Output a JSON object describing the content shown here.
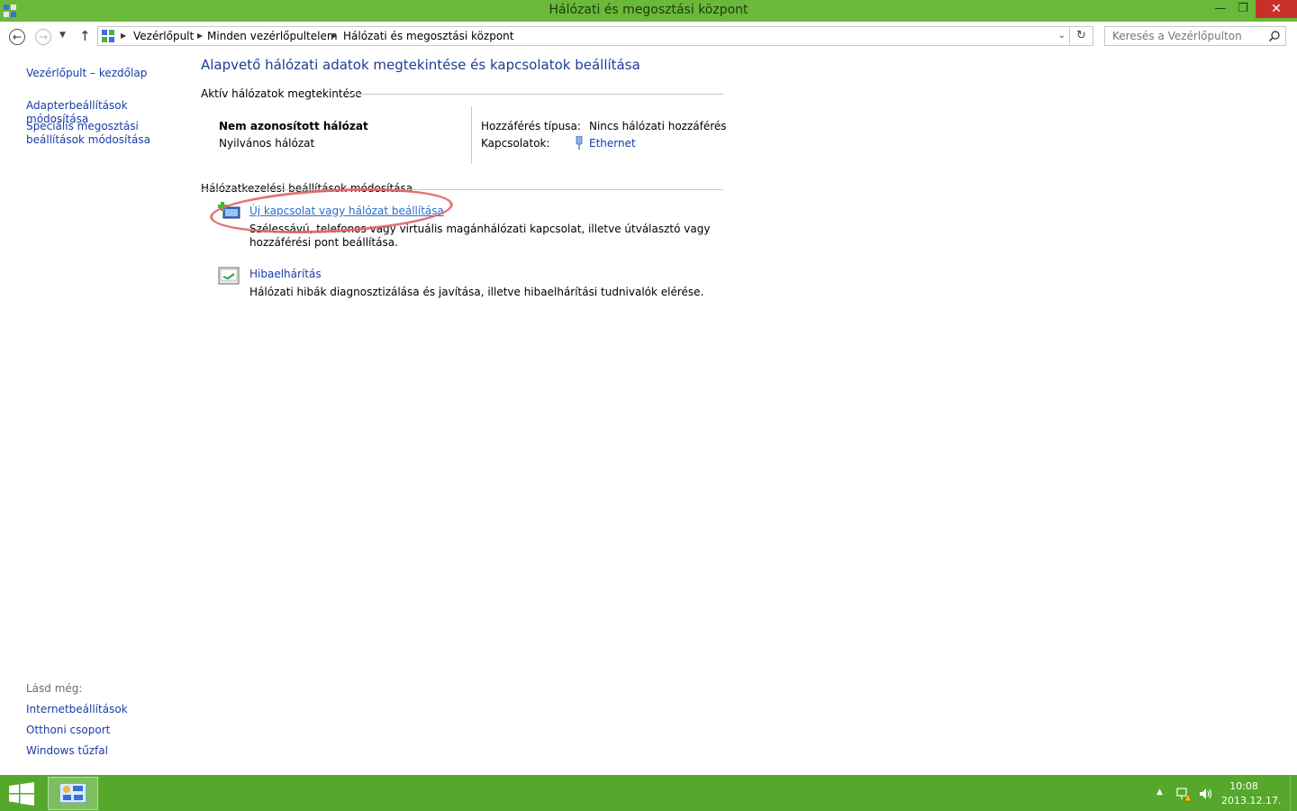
{
  "window": {
    "title": "Hálózati és megosztási központ",
    "min_label": "—",
    "max_label": "❐",
    "close_label": "✕"
  },
  "navigation": {
    "back": "←",
    "forward": "→",
    "dropdown": "▼",
    "up": "↑",
    "breadcrumbs": [
      "Vezérlőpult",
      "Minden vezérlőpultelem",
      "Hálózati és megosztási központ"
    ],
    "breadcrumb_sep": "▶",
    "address_dropdown": "⌄",
    "refresh": "↻",
    "search_placeholder": "Keresés a Vezérlőpulton"
  },
  "sidebar": {
    "home": "Vezérlőpult – kezdőlap",
    "items": [
      "Adapterbeállítások módosítása",
      "Speciális megosztási beállítások módosítása"
    ],
    "see_also_label": "Lásd még:",
    "see_also": [
      "Internetbeállítások",
      "Otthoni csoport",
      "Windows tűzfal"
    ]
  },
  "main": {
    "title": "Alapvető hálózati adatok megtekintése és kapcsolatok beállítása",
    "active_section": "Aktív hálózatok megtekintése",
    "network": {
      "name": "Nem azonosított hálózat",
      "type": "Nyilvános hálózat",
      "access_label": "Hozzáférés típusa:",
      "access_value": "Nincs hálózati hozzáférés",
      "connections_label": "Kapcsolatok:",
      "connections_value": "Ethernet"
    },
    "settings_section": "Hálózatkezelési beállítások módosítása",
    "tasks": [
      {
        "title": "Új kapcsolat vagy hálózat beállítása",
        "desc": "Szélessávú, telefonos vagy virtuális magánhálózati kapcsolat, illetve útválasztó vagy hozzáférési pont beállítása."
      },
      {
        "title": "Hibaelhárítás",
        "desc": "Hálózati hibák diagnosztizálása és javítása, illetve hibaelhárítási tudnivalók elérése."
      }
    ]
  },
  "taskbar": {
    "tray_up": "▲",
    "time": "10:08",
    "date": "2013.12.17."
  },
  "colors": {
    "accent": "#6ab93a",
    "taskbar": "#55a82b",
    "link": "#1a3ca8",
    "title": "#1e3c96",
    "annotation": "#e06466"
  }
}
